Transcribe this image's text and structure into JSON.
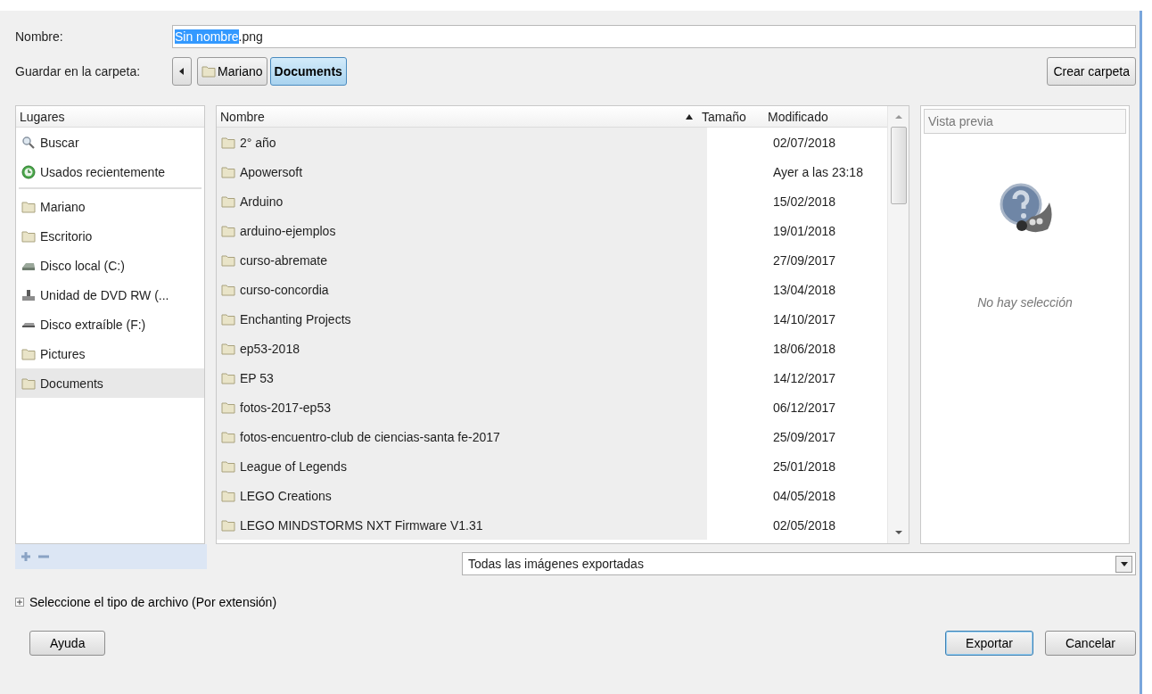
{
  "name_row": {
    "label": "Nombre:",
    "selected_text": "Sin nombre",
    "rest_text": ".png"
  },
  "folder_row": {
    "label": "Guardar en la carpeta:",
    "path": [
      {
        "label": "Mariano",
        "kind": "home",
        "selected": false
      },
      {
        "label": "Documents",
        "kind": "folder",
        "selected": true
      }
    ],
    "create_button": "Crear carpeta"
  },
  "places": {
    "header": "Lugares",
    "shortcuts": [
      {
        "label": "Buscar",
        "kind": "search",
        "selected": false
      },
      {
        "label": "Usados recientemente",
        "kind": "recent",
        "selected": false
      }
    ],
    "bookmarks": [
      {
        "label": "Mariano",
        "kind": "folder",
        "selected": false
      },
      {
        "label": "Escritorio",
        "kind": "folder",
        "selected": false
      },
      {
        "label": "Disco local (C:)",
        "kind": "drive",
        "selected": false
      },
      {
        "label": "Unidad de DVD RW (...",
        "kind": "dvd",
        "selected": false
      },
      {
        "label": "Disco extraíble (F:)",
        "kind": "removable",
        "selected": false
      },
      {
        "label": "Pictures",
        "kind": "folder",
        "selected": false
      },
      {
        "label": "Documents",
        "kind": "folder",
        "selected": true
      }
    ]
  },
  "file_list": {
    "columns": [
      "Nombre",
      "Tamaño",
      "Modificado"
    ],
    "rows": [
      {
        "name": "2° año",
        "modified": "02/07/2018"
      },
      {
        "name": "Apowersoft",
        "modified": "Ayer a las 23:18"
      },
      {
        "name": "Arduino",
        "modified": "15/02/2018"
      },
      {
        "name": "arduino-ejemplos",
        "modified": "19/01/2018"
      },
      {
        "name": "curso-abremate",
        "modified": "27/09/2017"
      },
      {
        "name": "curso-concordia",
        "modified": "13/04/2018"
      },
      {
        "name": "Enchanting Projects",
        "modified": "14/10/2017"
      },
      {
        "name": "ep53-2018",
        "modified": "18/06/2018"
      },
      {
        "name": "EP 53",
        "modified": "14/12/2017"
      },
      {
        "name": "fotos-2017-ep53",
        "modified": "06/12/2017"
      },
      {
        "name": "fotos-encuentro-club de ciencias-santa fe-2017",
        "modified": "25/09/2017"
      },
      {
        "name": "League of Legends",
        "modified": "25/01/2018"
      },
      {
        "name": "LEGO Creations",
        "modified": "04/05/2018"
      },
      {
        "name": "LEGO MINDSTORMS NXT Firmware V1.31",
        "modified": "02/05/2018"
      }
    ]
  },
  "preview": {
    "header": "Vista previa",
    "message": "No hay selección"
  },
  "filter": {
    "value": "Todas las imágenes exportadas"
  },
  "file_type_expander": {
    "label": "Seleccione el tipo de archivo (Por extensión)",
    "expanded": false
  },
  "buttons_left": [
    {
      "label": "Ayuda",
      "default": false
    }
  ],
  "buttons_right": [
    {
      "label": "Exportar",
      "default": true
    },
    {
      "label": "Cancelar",
      "default": false
    }
  ]
}
